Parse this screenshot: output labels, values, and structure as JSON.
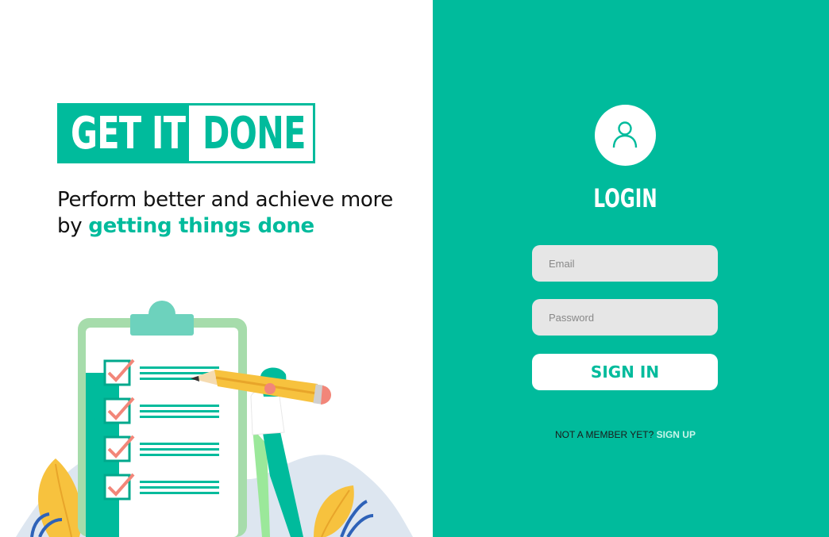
{
  "brand": {
    "logo_left": "GET IT",
    "logo_right": "DONE",
    "tagline_prefix": "Perform better and achieve more by ",
    "tagline_highlight": "getting things done"
  },
  "login": {
    "title": "LOGIN",
    "email_placeholder": "Email",
    "password_placeholder": "Password",
    "signin_label": "SIGN IN",
    "signup_prompt": "NOT A  MEMBER YET?",
    "signup_link": "SIGN UP"
  },
  "icons": {
    "avatar": "user-icon",
    "illustration": "checklist-illustration"
  },
  "colors": {
    "accent": "#00bb9c",
    "background": "#ffffff",
    "field": "#e6e6e6",
    "signup_link": "#c9f5ea"
  }
}
